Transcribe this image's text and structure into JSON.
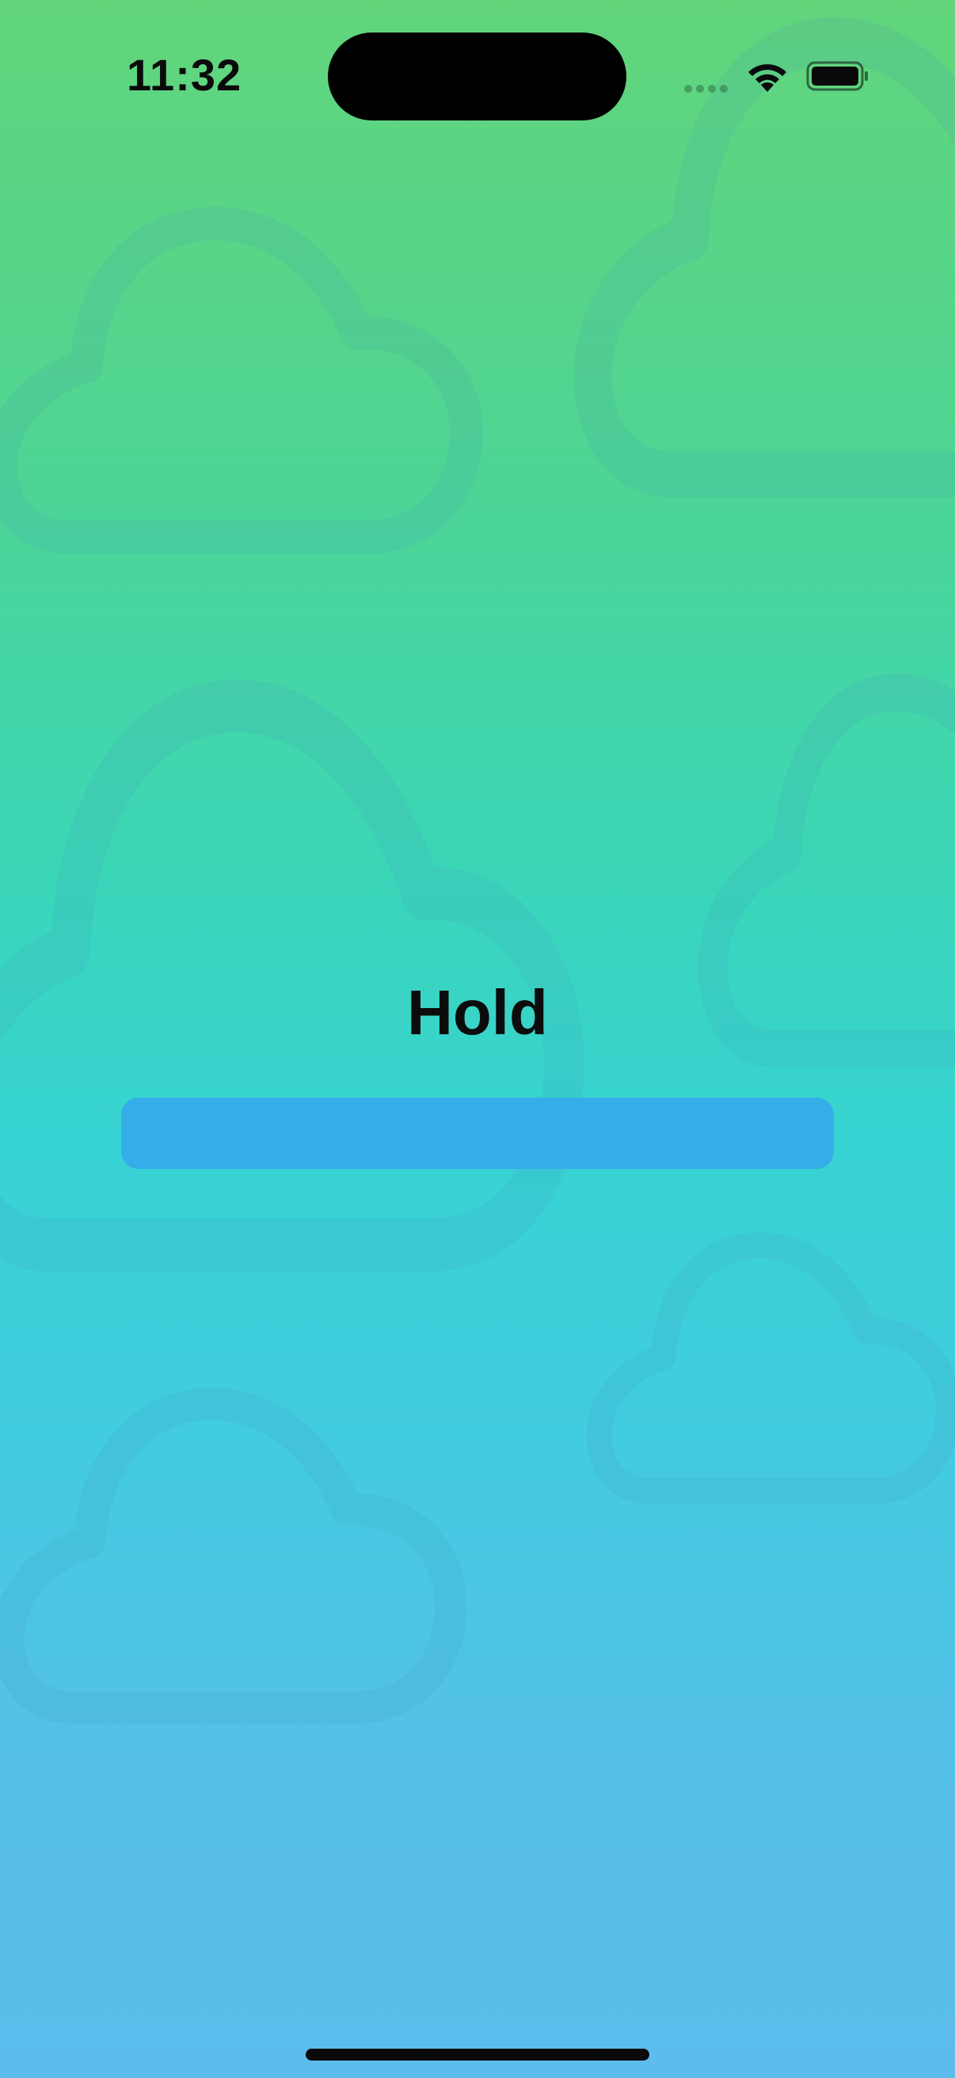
{
  "status_bar": {
    "time": "11:32",
    "signal_icon": "cellular-signal-icon",
    "wifi_icon": "wifi-icon",
    "battery_icon": "battery-icon",
    "battery_level": 1.0
  },
  "main": {
    "title": "Hold",
    "hold_bar_label": ""
  },
  "background": {
    "icon": "cloud-icon",
    "cloud_color": "#3aa8d8"
  },
  "colors": {
    "gradient_top": "#62d57b",
    "gradient_mid": "#37d3d3",
    "gradient_bottom": "#5cbdec",
    "hold_bar": "#35ade8",
    "text": "#0c0c0c"
  }
}
